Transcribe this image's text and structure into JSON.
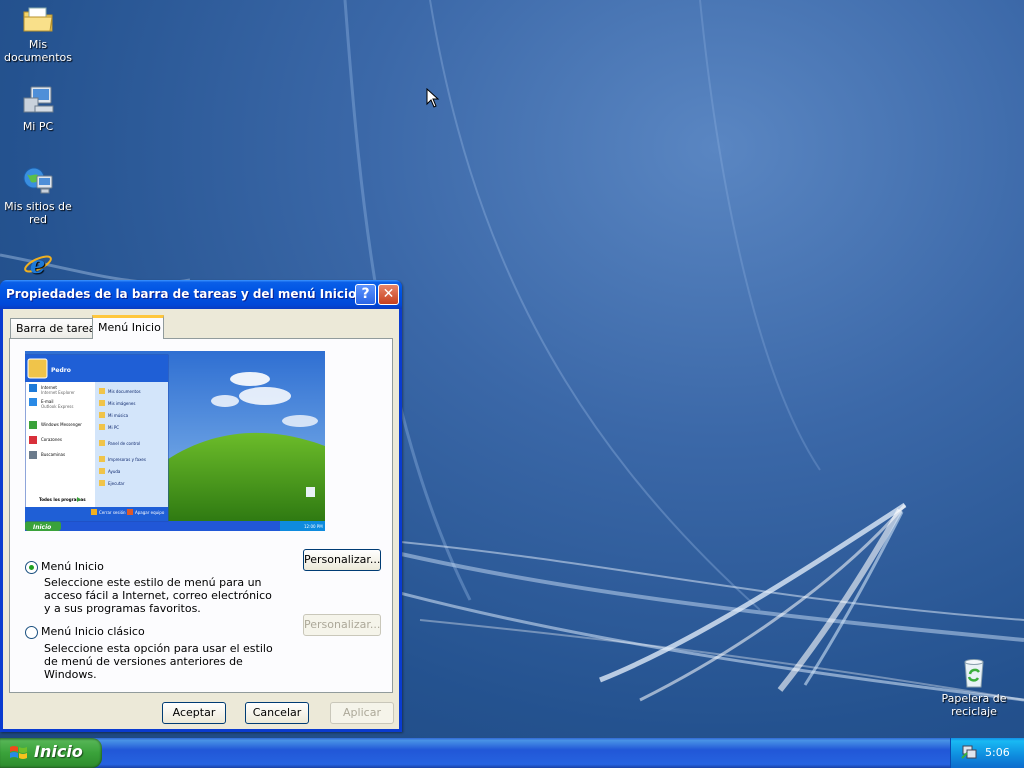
{
  "desktop": {
    "icons": [
      {
        "name": "my-documents",
        "label": "Mis documentos"
      },
      {
        "name": "my-computer",
        "label": "Mi PC"
      },
      {
        "name": "my-network",
        "label": "Mis sitios de red"
      },
      {
        "name": "internet-explorer",
        "label": ""
      },
      {
        "name": "recycle-bin",
        "label": "Papelera de reciclaje"
      }
    ]
  },
  "dialog": {
    "title": "Propiedades de la barra de tareas y del menú Inicio",
    "help_symbol": "?",
    "close_symbol": "✕",
    "tabs": [
      {
        "label": "Barra de tareas",
        "selected": false
      },
      {
        "label": "Menú Inicio",
        "selected": true
      }
    ],
    "options": [
      {
        "label": "Menú Inicio",
        "selected": true,
        "description": "Seleccione este estilo de menú para un acceso fácil a Internet, correo electrónico y a sus programas favoritos.",
        "button": "Personalizar...",
        "button_enabled": true
      },
      {
        "label": "Menú Inicio clásico",
        "selected": false,
        "description": "Seleccione esta opción para usar el estilo de menú de versiones anteriores de Windows.",
        "button": "Personalizar...",
        "button_enabled": false
      }
    ],
    "buttons": {
      "ok": "Aceptar",
      "cancel": "Cancelar",
      "apply": "Aplicar"
    },
    "preview": {
      "user": "Pedro",
      "left_items": [
        "Internet",
        "Internet Explorer",
        "E-mail",
        "Outlook Express",
        "Windows Messenger",
        "Corazones",
        "Buscaminas"
      ],
      "right_items": [
        "Mis documentos",
        "Mis imágenes",
        "Mi música",
        "Mi PC",
        "Panel de control",
        "Impresoras y faxes",
        "Ayuda",
        "Ejecutar"
      ],
      "all_programs": "Todos los programas",
      "bottom_buttons": [
        "Cerrar sesión",
        "Apagar equipo"
      ],
      "start_label": "Inicio",
      "recycle_label": "Papelera de reciclaje",
      "clock": "12:00 PM"
    }
  },
  "taskbar": {
    "start_label": "Inicio",
    "clock": "5:06"
  },
  "colors": {
    "titlebar": "#0054e3",
    "start_button": "#3aa23a",
    "taskbar": "#2157d7",
    "tray": "#0e8bde",
    "dialog_face": "#ece9d8"
  }
}
